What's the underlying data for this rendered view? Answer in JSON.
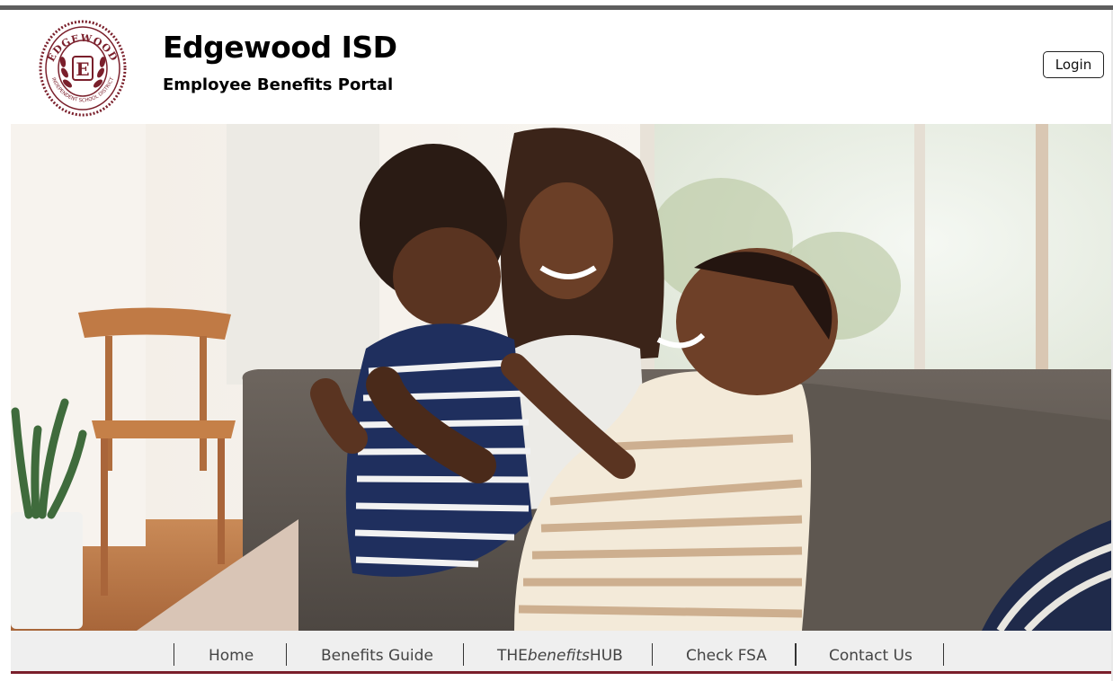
{
  "header": {
    "title": "Edgewood ISD",
    "subtitle": "Employee Benefits Portal",
    "login_label": "Login",
    "seal": {
      "arc_text": "EDGEWOOD",
      "lower_text": "INDEPENDENT SCHOOL DISTRICT",
      "letter": "E"
    }
  },
  "hero": {
    "description": "family photo"
  },
  "nav": {
    "items": [
      {
        "label": "Home"
      },
      {
        "label": "Benefits Guide"
      },
      {
        "label_prefix": "THE",
        "label_italic": "benefits",
        "label_suffix": "HUB"
      },
      {
        "label": "Check FSA"
      },
      {
        "label": "Contact Us"
      }
    ]
  },
  "colors": {
    "brand_maroon": "#7a1f2b",
    "top_bar": "#5e5e5e",
    "nav_bg": "#efefef"
  }
}
